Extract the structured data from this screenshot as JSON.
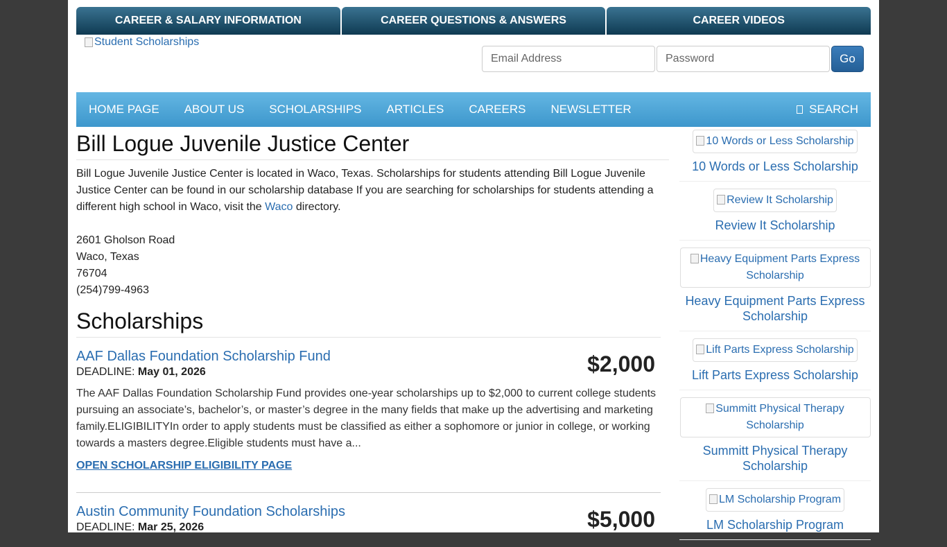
{
  "top_tabs": [
    "CAREER & SALARY INFORMATION",
    "CAREER QUESTIONS & ANSWERS",
    "CAREER VIDEOS"
  ],
  "logo_alt": "Student Scholarships",
  "login": {
    "email_placeholder": "Email Address",
    "password_placeholder": "Password",
    "go_label": "Go"
  },
  "nav": {
    "items": [
      "HOME PAGE",
      "ABOUT US",
      "SCHOLARSHIPS",
      "ARTICLES",
      "CAREERS",
      "NEWSLETTER"
    ],
    "search_label": "SEARCH"
  },
  "school": {
    "name": "Bill Logue Juvenile Justice Center",
    "intro_before": "Bill Logue Juvenile Justice Center is located in Waco, Texas. Scholarships for students attending Bill Logue Juvenile Justice Center can be found in our scholarship database If you are searching for scholarships for students attending a different high school in Waco, visit the ",
    "intro_link": "Waco",
    "intro_after": " directory.",
    "address": {
      "street": "2601 Gholson Road",
      "city_state": "Waco, Texas",
      "zip": "76704",
      "phone": "(254)799-4963"
    }
  },
  "scholarships_heading": "Scholarships",
  "scholarships": [
    {
      "name": "AAF Dallas Foundation Scholarship Fund",
      "deadline_label": "DEADLINE:",
      "deadline": "May 01, 2026",
      "amount": "$2,000",
      "description": "The AAF Dallas Foundation Scholarship Fund provides one-year scholarships up to $2,000 to current college students pursuing an associate’s, bachelor’s, or master’s degree in the many fields that make up the advertising and marketing family.ELIGIBILITYIn order to apply students must be classified as either a sophomore or junior in college, or working towards a masters degree.Eligible students must have a...",
      "link_label": "OPEN SCHOLARSHIP ELIGIBILITY PAGE"
    },
    {
      "name": "Austin Community Foundation Scholarships",
      "deadline_label": "DEADLINE:",
      "deadline": "Mar 25, 2026",
      "amount": "$5,000"
    }
  ],
  "sidebar": [
    {
      "image_alt": "10 Words or Less Scholarship",
      "title": "10 Words or Less Scholarship",
      "wide": false
    },
    {
      "image_alt": "Review It Scholarship",
      "title": "Review It Scholarship",
      "wide": false
    },
    {
      "image_alt": "Heavy Equipment Parts Express Scholarship",
      "title": "Heavy Equipment Parts Express Scholarship",
      "wide": true
    },
    {
      "image_alt": "Lift Parts Express Scholarship",
      "title": "Lift Parts Express Scholarship",
      "wide": false
    },
    {
      "image_alt": "Summitt Physical Therapy Scholarship",
      "title": "Summitt Physical Therapy Scholarship",
      "wide": true
    },
    {
      "image_alt": "LM Scholarship Program",
      "title": "LM Scholarship Program",
      "wide": false
    }
  ]
}
